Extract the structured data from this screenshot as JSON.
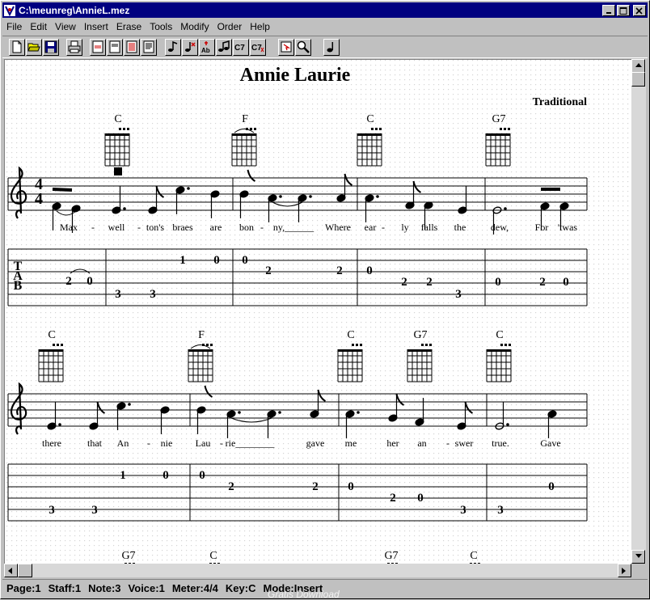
{
  "window": {
    "title": "C:\\meunreg\\AnnieL.mez",
    "accent": "#000080"
  },
  "menu": [
    "File",
    "Edit",
    "View",
    "Insert",
    "Erase",
    "Tools",
    "Modify",
    "Order",
    "Help"
  ],
  "toolbar_icons": [
    "new-file-icon",
    "open-folder-icon",
    "save-disk-icon",
    "print-icon",
    "page-layout-1-icon",
    "page-layout-2-icon",
    "page-layout-3-icon",
    "page-layout-4-icon",
    "note-icon",
    "note-red-icon",
    "lyric-text-icon",
    "notes-pair-icon",
    "chord-c7-icon",
    "chord-c7-red-icon",
    "pointer-insert-icon",
    "magnifier-icon",
    "single-note-icon"
  ],
  "score": {
    "title": "Annie Laurie",
    "composer": "Traditional",
    "time_signature": [
      "4",
      "4"
    ],
    "tab_letters": [
      "T",
      "A",
      "B"
    ],
    "systems": [
      {
        "chords": [
          "C",
          "F",
          "C",
          "G7"
        ],
        "lyrics": [
          "Max",
          "-",
          "well",
          "-",
          "ton's",
          "braes",
          "are",
          "bon",
          "-",
          "ny,______",
          "Where",
          "ear",
          "-",
          "ly",
          "falls",
          "the",
          "dew,",
          "For",
          "'twas"
        ],
        "tab_numbers": [
          "2",
          "0",
          "3",
          "3",
          "1",
          "0",
          "0",
          "2",
          "2",
          "0",
          "2",
          "2",
          "3",
          "0",
          "2",
          "0"
        ]
      },
      {
        "chords": [
          "C",
          "F",
          "C",
          "G7",
          "C"
        ],
        "lyrics": [
          "there",
          "that",
          "An",
          "-",
          "nie",
          "Lau",
          "-",
          "rie________",
          "gave",
          "me",
          "her",
          "an",
          "-",
          "swer",
          "true.",
          "Gave"
        ],
        "tab_numbers": [
          "1",
          "0",
          "3",
          "3",
          "0",
          "2",
          "2",
          "0",
          "2",
          "0",
          "3",
          "3",
          "0"
        ]
      },
      {
        "chords": [
          "G7",
          "C",
          "G7",
          "C"
        ]
      }
    ]
  },
  "status": {
    "page": "Page:1",
    "staff": "Staff:1",
    "note": "Note:3",
    "voice": "Voice:1",
    "meter": "Meter:4/4",
    "key": "Key:C",
    "mode": "Mode:Insert"
  },
  "watermark": "Gratis Download"
}
